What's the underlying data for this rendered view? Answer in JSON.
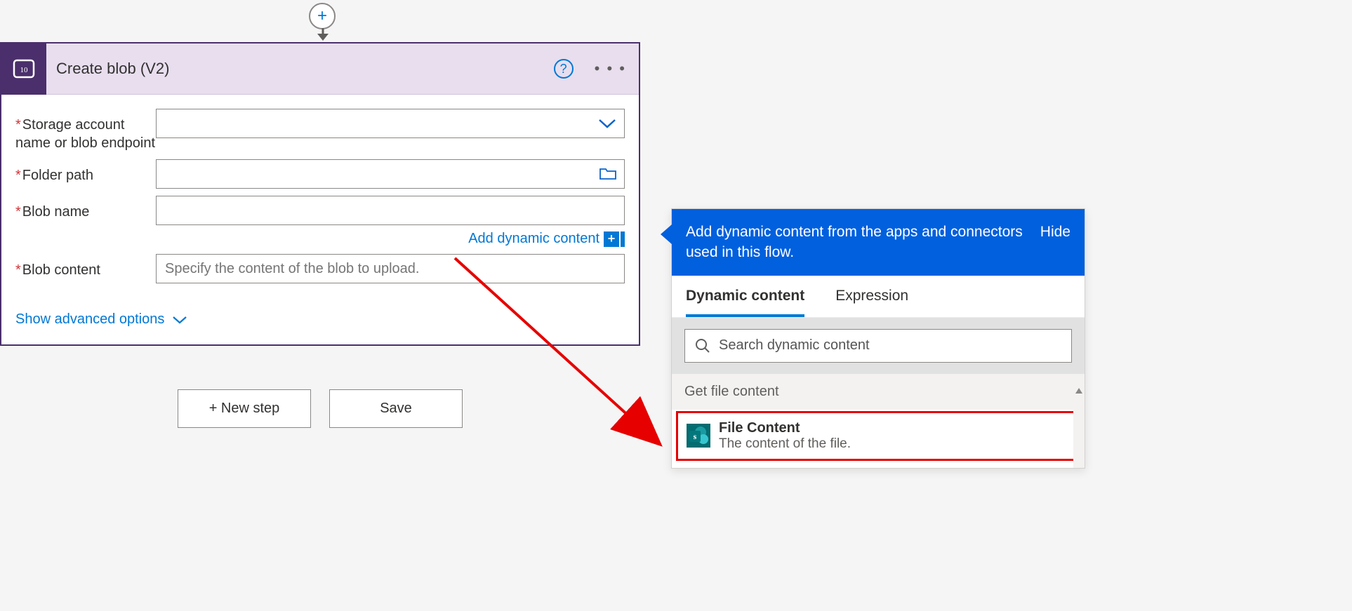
{
  "card": {
    "title": "Create blob (V2)",
    "fields": {
      "storage_label": "Storage account name or blob endpoint",
      "folder_label": "Folder path",
      "blob_name_label": "Blob name",
      "blob_content_label": "Blob content",
      "blob_content_placeholder": "Specify the content of the blob to upload."
    },
    "add_dynamic_link": "Add dynamic content",
    "show_advanced": "Show advanced options"
  },
  "buttons": {
    "new_step": "+ New step",
    "save": "Save"
  },
  "popover": {
    "header_text": "Add dynamic content from the apps and connectors used in this flow.",
    "hide_label": "Hide",
    "tabs": {
      "dynamic": "Dynamic content",
      "expression": "Expression"
    },
    "search_placeholder": "Search dynamic content",
    "group_header": "Get file content",
    "item": {
      "title": "File Content",
      "subtitle": "The content of the file."
    }
  }
}
